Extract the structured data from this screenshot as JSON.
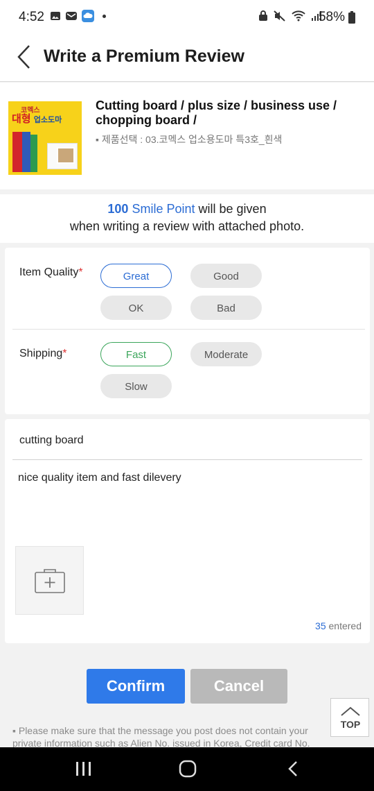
{
  "status_bar": {
    "time": "4:52",
    "battery": "58%"
  },
  "header": {
    "title": "Write a Premium Review"
  },
  "product": {
    "thumb_text_top": "코멕스",
    "thumb_text_red": "대형",
    "thumb_text_rest": "업소도마",
    "name": "Cutting board / plus size / business use / chopping board /",
    "option": "▪ 제품선택 : 03.코멕스 업소용도마 특3호_흰색"
  },
  "notice": {
    "points": "100",
    "point_name": "Smile Point",
    "line1_rest": "will be given",
    "line2": "when writing a review with attached photo."
  },
  "rating": {
    "item_quality_label": "Item Quality",
    "shipping_label": "Shipping",
    "required_mark": "*",
    "quality_options": [
      "Great",
      "Good",
      "OK",
      "Bad"
    ],
    "quality_selected": "Great",
    "shipping_options": [
      "Fast",
      "Moderate",
      "Slow"
    ],
    "shipping_selected": "Fast"
  },
  "review": {
    "subject": "cutting board",
    "body": "nice quality item and fast dilevery",
    "char_count": "35",
    "char_count_suffix": "entered"
  },
  "buttons": {
    "confirm": "Confirm",
    "cancel": "Cancel"
  },
  "disclaimer": {
    "line1": "▪ Please make sure that the message you post does not contain your",
    "line2": "private information such as Alien No. issued in Korea, Credit card No."
  },
  "top_button": {
    "label": "TOP"
  },
  "colors": {
    "accent_blue": "#2b6cd4",
    "confirm_blue": "#2f7ae9",
    "shipping_green": "#3aa55a",
    "required_red": "#dd3333"
  }
}
